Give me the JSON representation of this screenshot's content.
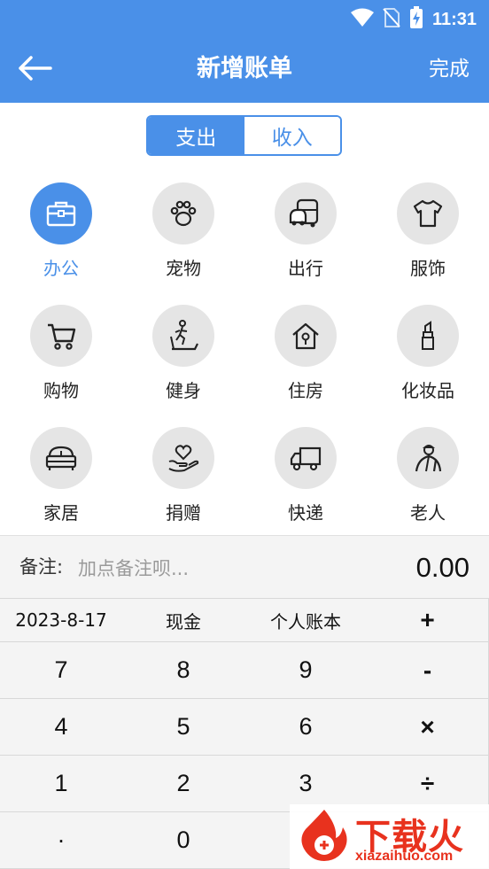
{
  "status_bar": {
    "time": "11:31"
  },
  "app_bar": {
    "title": "新增账单",
    "done_label": "完成"
  },
  "type_toggle": {
    "expense_label": "支出",
    "income_label": "收入"
  },
  "categories": [
    {
      "label": "办公",
      "icon": "briefcase-icon",
      "active": true
    },
    {
      "label": "宠物",
      "icon": "paw-icon"
    },
    {
      "label": "出行",
      "icon": "bus-icon"
    },
    {
      "label": "服饰",
      "icon": "tshirt-icon"
    },
    {
      "label": "购物",
      "icon": "cart-icon"
    },
    {
      "label": "健身",
      "icon": "treadmill-icon"
    },
    {
      "label": "住房",
      "icon": "house-icon"
    },
    {
      "label": "化妆品",
      "icon": "lipstick-icon"
    },
    {
      "label": "家居",
      "icon": "sofa-icon"
    },
    {
      "label": "捐赠",
      "icon": "heart-hand-icon"
    },
    {
      "label": "快递",
      "icon": "truck-icon"
    },
    {
      "label": "老人",
      "icon": "elder-icon"
    }
  ],
  "note": {
    "label": "备注:",
    "placeholder": "加点备注呗...",
    "amount": "0.00"
  },
  "keypad": {
    "date": "2023-8-17",
    "payment": "现金",
    "account": "个人账本",
    "keys": [
      "+",
      "7",
      "8",
      "9",
      "-",
      "4",
      "5",
      "6",
      "×",
      "1",
      "2",
      "3",
      "÷",
      "·",
      "0"
    ]
  },
  "watermark": {
    "brand": "下载火",
    "url": "xiazaihuo.com"
  },
  "colors": {
    "accent": "#4a90e8",
    "icon_bg": "#e5e5e5",
    "watermark": "#e8321e"
  }
}
